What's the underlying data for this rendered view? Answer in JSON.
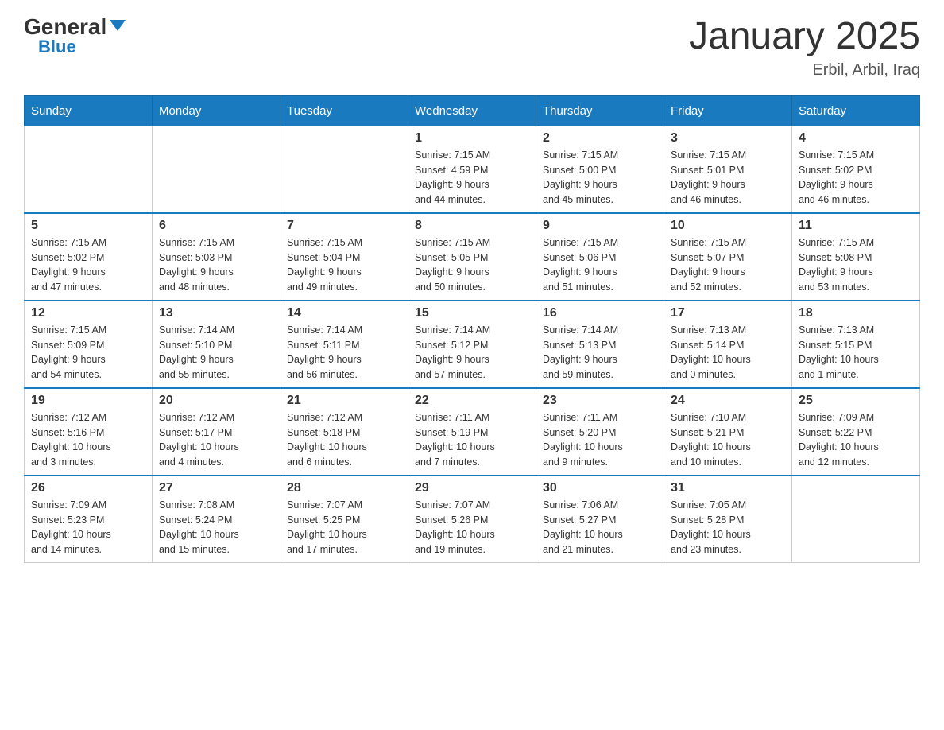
{
  "logo": {
    "general": "General",
    "blue": "Blue"
  },
  "title": "January 2025",
  "subtitle": "Erbil, Arbil, Iraq",
  "days": [
    "Sunday",
    "Monday",
    "Tuesday",
    "Wednesday",
    "Thursday",
    "Friday",
    "Saturday"
  ],
  "weeks": [
    [
      {
        "day": "",
        "info": ""
      },
      {
        "day": "",
        "info": ""
      },
      {
        "day": "",
        "info": ""
      },
      {
        "day": "1",
        "info": "Sunrise: 7:15 AM\nSunset: 4:59 PM\nDaylight: 9 hours\nand 44 minutes."
      },
      {
        "day": "2",
        "info": "Sunrise: 7:15 AM\nSunset: 5:00 PM\nDaylight: 9 hours\nand 45 minutes."
      },
      {
        "day": "3",
        "info": "Sunrise: 7:15 AM\nSunset: 5:01 PM\nDaylight: 9 hours\nand 46 minutes."
      },
      {
        "day": "4",
        "info": "Sunrise: 7:15 AM\nSunset: 5:02 PM\nDaylight: 9 hours\nand 46 minutes."
      }
    ],
    [
      {
        "day": "5",
        "info": "Sunrise: 7:15 AM\nSunset: 5:02 PM\nDaylight: 9 hours\nand 47 minutes."
      },
      {
        "day": "6",
        "info": "Sunrise: 7:15 AM\nSunset: 5:03 PM\nDaylight: 9 hours\nand 48 minutes."
      },
      {
        "day": "7",
        "info": "Sunrise: 7:15 AM\nSunset: 5:04 PM\nDaylight: 9 hours\nand 49 minutes."
      },
      {
        "day": "8",
        "info": "Sunrise: 7:15 AM\nSunset: 5:05 PM\nDaylight: 9 hours\nand 50 minutes."
      },
      {
        "day": "9",
        "info": "Sunrise: 7:15 AM\nSunset: 5:06 PM\nDaylight: 9 hours\nand 51 minutes."
      },
      {
        "day": "10",
        "info": "Sunrise: 7:15 AM\nSunset: 5:07 PM\nDaylight: 9 hours\nand 52 minutes."
      },
      {
        "day": "11",
        "info": "Sunrise: 7:15 AM\nSunset: 5:08 PM\nDaylight: 9 hours\nand 53 minutes."
      }
    ],
    [
      {
        "day": "12",
        "info": "Sunrise: 7:15 AM\nSunset: 5:09 PM\nDaylight: 9 hours\nand 54 minutes."
      },
      {
        "day": "13",
        "info": "Sunrise: 7:14 AM\nSunset: 5:10 PM\nDaylight: 9 hours\nand 55 minutes."
      },
      {
        "day": "14",
        "info": "Sunrise: 7:14 AM\nSunset: 5:11 PM\nDaylight: 9 hours\nand 56 minutes."
      },
      {
        "day": "15",
        "info": "Sunrise: 7:14 AM\nSunset: 5:12 PM\nDaylight: 9 hours\nand 57 minutes."
      },
      {
        "day": "16",
        "info": "Sunrise: 7:14 AM\nSunset: 5:13 PM\nDaylight: 9 hours\nand 59 minutes."
      },
      {
        "day": "17",
        "info": "Sunrise: 7:13 AM\nSunset: 5:14 PM\nDaylight: 10 hours\nand 0 minutes."
      },
      {
        "day": "18",
        "info": "Sunrise: 7:13 AM\nSunset: 5:15 PM\nDaylight: 10 hours\nand 1 minute."
      }
    ],
    [
      {
        "day": "19",
        "info": "Sunrise: 7:12 AM\nSunset: 5:16 PM\nDaylight: 10 hours\nand 3 minutes."
      },
      {
        "day": "20",
        "info": "Sunrise: 7:12 AM\nSunset: 5:17 PM\nDaylight: 10 hours\nand 4 minutes."
      },
      {
        "day": "21",
        "info": "Sunrise: 7:12 AM\nSunset: 5:18 PM\nDaylight: 10 hours\nand 6 minutes."
      },
      {
        "day": "22",
        "info": "Sunrise: 7:11 AM\nSunset: 5:19 PM\nDaylight: 10 hours\nand 7 minutes."
      },
      {
        "day": "23",
        "info": "Sunrise: 7:11 AM\nSunset: 5:20 PM\nDaylight: 10 hours\nand 9 minutes."
      },
      {
        "day": "24",
        "info": "Sunrise: 7:10 AM\nSunset: 5:21 PM\nDaylight: 10 hours\nand 10 minutes."
      },
      {
        "day": "25",
        "info": "Sunrise: 7:09 AM\nSunset: 5:22 PM\nDaylight: 10 hours\nand 12 minutes."
      }
    ],
    [
      {
        "day": "26",
        "info": "Sunrise: 7:09 AM\nSunset: 5:23 PM\nDaylight: 10 hours\nand 14 minutes."
      },
      {
        "day": "27",
        "info": "Sunrise: 7:08 AM\nSunset: 5:24 PM\nDaylight: 10 hours\nand 15 minutes."
      },
      {
        "day": "28",
        "info": "Sunrise: 7:07 AM\nSunset: 5:25 PM\nDaylight: 10 hours\nand 17 minutes."
      },
      {
        "day": "29",
        "info": "Sunrise: 7:07 AM\nSunset: 5:26 PM\nDaylight: 10 hours\nand 19 minutes."
      },
      {
        "day": "30",
        "info": "Sunrise: 7:06 AM\nSunset: 5:27 PM\nDaylight: 10 hours\nand 21 minutes."
      },
      {
        "day": "31",
        "info": "Sunrise: 7:05 AM\nSunset: 5:28 PM\nDaylight: 10 hours\nand 23 minutes."
      },
      {
        "day": "",
        "info": ""
      }
    ]
  ]
}
